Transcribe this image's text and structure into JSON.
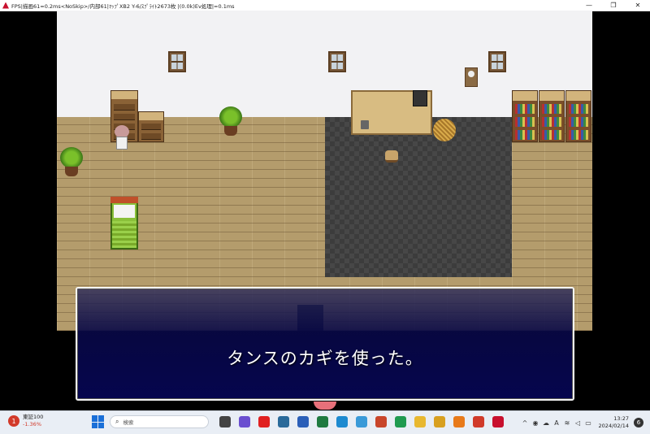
{
  "window": {
    "title": "FPS|描画61=0.2ms<NoSkip>/内部61|ﾏｯﾌﾟXB2 Y-6/ｽﾌﾟﾗｲﾄ2673枚 |(0.0k)Ev処理|=0.1ms",
    "min_glyph": "—",
    "max_glyph": "❐",
    "close_glyph": "✕"
  },
  "message": {
    "text": "タンスのカギを使った。"
  },
  "taskbar": {
    "weather_name": "東証100",
    "weather_change": "-1.36%",
    "weather_badge": "1",
    "search_placeholder": "検索",
    "time": "13:27",
    "date": "2024/02/14",
    "notification_count": "6",
    "ime": "A",
    "apps": [
      {
        "name": "task-view",
        "color": "#444444"
      },
      {
        "name": "chat",
        "color": "#6a4fd0"
      },
      {
        "name": "youtube",
        "color": "#e02020"
      },
      {
        "name": "media",
        "color": "#2a6a9a"
      },
      {
        "name": "word",
        "color": "#2b5fb8"
      },
      {
        "name": "excel",
        "color": "#1f7a40"
      },
      {
        "name": "edge",
        "color": "#1d8ad0"
      },
      {
        "name": "chrome-alt",
        "color": "#3a9ad8"
      },
      {
        "name": "powerpoint",
        "color": "#c8452a"
      },
      {
        "name": "sheets",
        "color": "#1f9a50"
      },
      {
        "name": "folder",
        "color": "#e8b830"
      },
      {
        "name": "chrome",
        "color": "#d8a020"
      },
      {
        "name": "blender",
        "color": "#e87a1a"
      },
      {
        "name": "gmail",
        "color": "#d03a2a"
      },
      {
        "name": "rpg-maker",
        "color": "#c8102e"
      }
    ],
    "accent": "#1a6fd8"
  }
}
